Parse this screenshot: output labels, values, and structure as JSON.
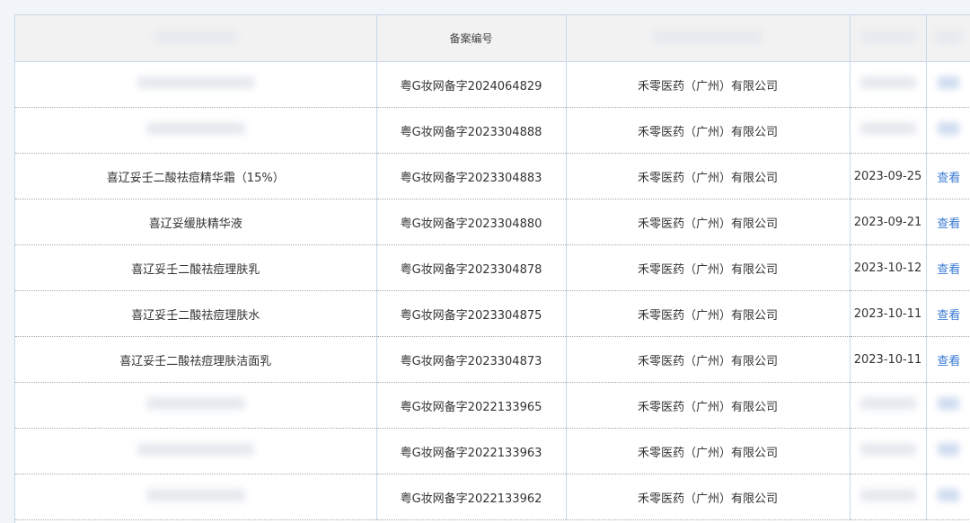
{
  "table": {
    "columns": [
      {
        "key": "name",
        "label": ""
      },
      {
        "key": "record_no",
        "label": "备案编号"
      },
      {
        "key": "company",
        "label": ""
      },
      {
        "key": "date",
        "label": ""
      },
      {
        "key": "action",
        "label": ""
      }
    ],
    "rows": [
      {
        "name": "",
        "record_no": "粤G妆网备字2024064829",
        "company": "禾零医药（广州）有限公司",
        "date": "",
        "action": ""
      },
      {
        "name": "",
        "record_no": "粤G妆网备字2023304888",
        "company": "禾零医药（广州）有限公司",
        "date": "",
        "action": ""
      },
      {
        "name": "喜辽妥壬二酸祛痘精华霜（15%）",
        "record_no": "粤G妆网备字2023304883",
        "company": "禾零医药（广州）有限公司",
        "date": "2023-09-25",
        "action": "查看"
      },
      {
        "name": "喜辽妥缓肤精华液",
        "record_no": "粤G妆网备字2023304880",
        "company": "禾零医药（广州）有限公司",
        "date": "2023-09-21",
        "action": "查看"
      },
      {
        "name": "喜辽妥壬二酸祛痘理肤乳",
        "record_no": "粤G妆网备字2023304878",
        "company": "禾零医药（广州）有限公司",
        "date": "2023-10-12",
        "action": "查看"
      },
      {
        "name": "喜辽妥壬二酸祛痘理肤水",
        "record_no": "粤G妆网备字2023304875",
        "company": "禾零医药（广州）有限公司",
        "date": "2023-10-11",
        "action": "查看"
      },
      {
        "name": "喜辽妥壬二酸祛痘理肤洁面乳",
        "record_no": "粤G妆网备字2023304873",
        "company": "禾零医药（广州）有限公司",
        "date": "2023-10-11",
        "action": "查看"
      },
      {
        "name": "",
        "record_no": "粤G妆网备字2022133965",
        "company": "禾零医药（广州）有限公司",
        "date": "",
        "action": ""
      },
      {
        "name": "",
        "record_no": "粤G妆网备字2022133963",
        "company": "禾零医药（广州）有限公司",
        "date": "",
        "action": ""
      },
      {
        "name": "",
        "record_no": "粤G妆网备字2022133962",
        "company": "禾零医药（广州）有限公司",
        "date": "",
        "action": ""
      }
    ]
  },
  "colors": {
    "link": "#3a7bd5",
    "border": "#c9d8ea",
    "header_bg": "#f2f2f2",
    "page_bg": "#f1f4f8"
  }
}
